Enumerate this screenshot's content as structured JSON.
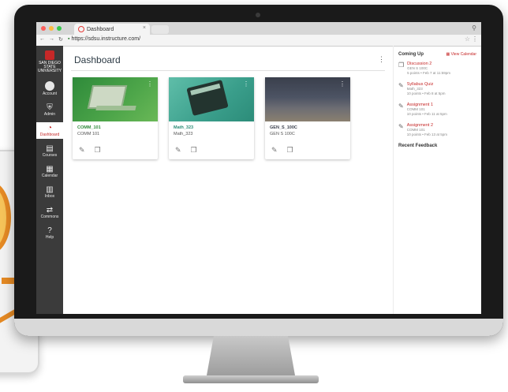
{
  "browser": {
    "tab_title": "Dashboard",
    "url": "https://sdsu.instructure.com/"
  },
  "global_nav": {
    "logo_text": "SAN DIEGO STATE UNIVERSITY",
    "items": [
      {
        "label": "Account",
        "icon": "avatar-icon"
      },
      {
        "label": "Admin",
        "icon": "shield-icon"
      },
      {
        "label": "Dashboard",
        "icon": "dashboard-icon",
        "active": true
      },
      {
        "label": "Courses",
        "icon": "book-icon"
      },
      {
        "label": "Calendar",
        "icon": "calendar-icon"
      },
      {
        "label": "Inbox",
        "icon": "inbox-icon"
      },
      {
        "label": "Commons",
        "icon": "commons-icon"
      },
      {
        "label": "Help",
        "icon": "help-icon"
      }
    ]
  },
  "dashboard": {
    "title": "Dashboard",
    "cards": [
      {
        "code": "COMM_101",
        "name": "COMM 101",
        "color": "#2e8a3a"
      },
      {
        "code": "Math_323",
        "name": "Math_323",
        "color": "#3a9e8b"
      },
      {
        "code": "GEN_S_100C",
        "name": "GEN S 100C",
        "color": "#4c5363"
      }
    ]
  },
  "sidebar": {
    "coming_up": "Coming Up",
    "view_calendar": "View Calendar",
    "items": [
      {
        "title": "Discussion 2",
        "course": "GEN S 100C",
        "detail": "5 points • Feb 7 at 11:59pm"
      },
      {
        "title": "Syllabus Quiz",
        "course": "Math_323",
        "detail": "10 points • Feb 8 at 5pm"
      },
      {
        "title": "Assignment 1",
        "course": "COMM 101",
        "detail": "10 points • Feb 11 at 5pm"
      },
      {
        "title": "Assignment 2",
        "course": "COMM 101",
        "detail": "10 points • Feb 13 at 5pm"
      }
    ],
    "recent_feedback": "Recent Feedback"
  },
  "colors": {
    "canvas_red": "#c62828",
    "nav_dark": "#3b3b3b"
  }
}
